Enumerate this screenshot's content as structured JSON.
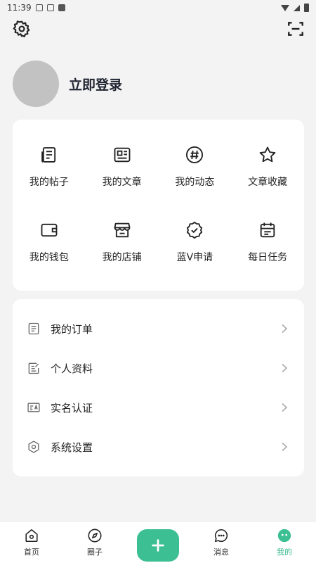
{
  "status_bar": {
    "time": "11:39"
  },
  "profile": {
    "login_label": "立即登录"
  },
  "grid": {
    "items": [
      {
        "label": "我的帖子",
        "icon": "post-icon"
      },
      {
        "label": "我的文章",
        "icon": "article-icon"
      },
      {
        "label": "我的动态",
        "icon": "hashtag-icon"
      },
      {
        "label": "文章收藏",
        "icon": "star-icon"
      },
      {
        "label": "我的钱包",
        "icon": "wallet-icon"
      },
      {
        "label": "我的店铺",
        "icon": "store-icon"
      },
      {
        "label": "蓝V申请",
        "icon": "verified-badge-icon"
      },
      {
        "label": "每日任务",
        "icon": "calendar-task-icon"
      }
    ]
  },
  "menu": {
    "items": [
      {
        "label": "我的订单",
        "icon": "order-list-icon"
      },
      {
        "label": "个人资料",
        "icon": "edit-profile-icon"
      },
      {
        "label": "实名认证",
        "icon": "id-card-icon"
      },
      {
        "label": "系统设置",
        "icon": "settings-hex-icon"
      }
    ]
  },
  "tabbar": {
    "items": [
      {
        "label": "首页",
        "icon": "home-icon"
      },
      {
        "label": "圈子",
        "icon": "compass-icon"
      },
      {
        "label": "",
        "icon": "plus-icon"
      },
      {
        "label": "消息",
        "icon": "message-icon"
      },
      {
        "label": "我的",
        "icon": "profile-face-icon"
      }
    ],
    "active_color": "#34b98b"
  },
  "colors": {
    "accent": "#3cbf93",
    "background": "#f3f3f3"
  }
}
